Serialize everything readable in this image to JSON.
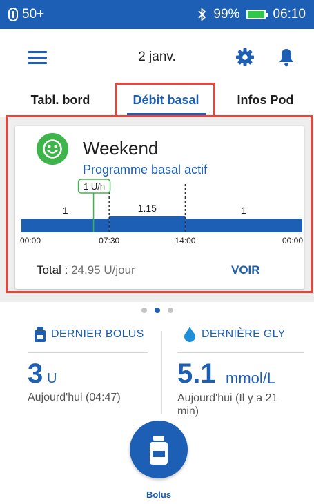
{
  "status_bar": {
    "pod_status": "50+",
    "battery_percent": "99%",
    "time": "06:10"
  },
  "header": {
    "date": "2 janv.",
    "menu_icon": "hamburger-menu-icon",
    "settings_icon": "gear-icon",
    "notifications_icon": "bell-icon"
  },
  "tabs": [
    {
      "label": "Tabl. bord",
      "active": false
    },
    {
      "label": "Débit basal",
      "active": true
    },
    {
      "label": "Infos Pod",
      "active": false
    }
  ],
  "basal_card": {
    "program_name": "Weekend",
    "program_status": "Programme basal actif",
    "current_rate_marker": "1 U/h",
    "total_label": "Total :",
    "total_value": "24.95 U/jour",
    "view_button": "VOIR"
  },
  "chart_data": {
    "type": "area",
    "x_ticks": [
      "00:00",
      "07:30",
      "14:00",
      "00:00"
    ],
    "segments": [
      {
        "start": "00:00",
        "end": "07:30",
        "rate": 1,
        "label": "1"
      },
      {
        "start": "07:30",
        "end": "14:00",
        "rate": 1.15,
        "label": "1.15"
      },
      {
        "start": "14:00",
        "end": "24:00",
        "rate": 1,
        "label": "1"
      }
    ],
    "current_time": "06:10"
  },
  "carousel": {
    "pages": 3,
    "active_index": 1
  },
  "last_bolus": {
    "title": "DERNIER BOLUS",
    "value": "3",
    "unit": "U",
    "time": "Aujourd'hui (04:47)"
  },
  "last_bg": {
    "title": "DERNIÈRE GLY",
    "value": "5.1",
    "unit": "mmol/L",
    "time": "Aujourd'hui (Il y a 21 min)"
  },
  "bolus_button": {
    "label": "Bolus"
  },
  "colors": {
    "primary": "#1d5fb5",
    "highlight": "#e8443a",
    "active_green": "#3eb54a"
  }
}
